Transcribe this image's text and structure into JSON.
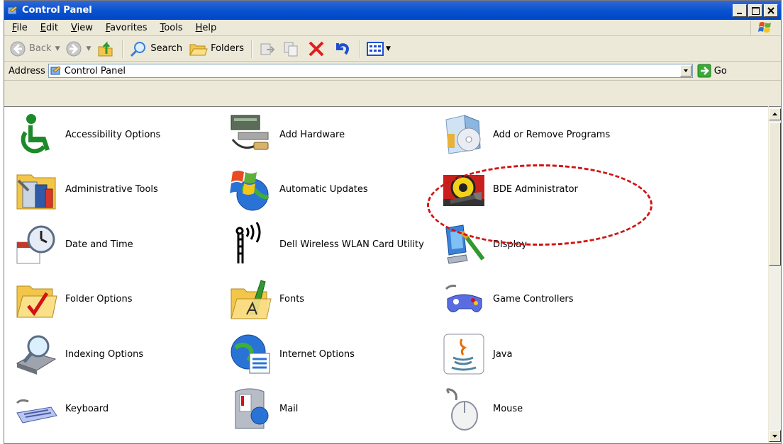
{
  "window": {
    "title": "Control Panel"
  },
  "menu": [
    "File",
    "Edit",
    "View",
    "Favorites",
    "Tools",
    "Help"
  ],
  "toolbar": {
    "back_label": "Back",
    "search_label": "Search",
    "folders_label": "Folders"
  },
  "address": {
    "label": "Address",
    "value": "Control Panel",
    "go_label": "Go"
  },
  "items": [
    {
      "label": "Accessibility Options",
      "icon": "wheelchair-icon"
    },
    {
      "label": "Add Hardware",
      "icon": "hardware-icon"
    },
    {
      "label": "Add or Remove Programs",
      "icon": "software-box-icon"
    },
    {
      "label": "Administrative Tools",
      "icon": "admin-tools-icon"
    },
    {
      "label": "Automatic Updates",
      "icon": "windows-globe-icon"
    },
    {
      "label": "BDE Administrator",
      "icon": "gear-wrench-icon"
    },
    {
      "label": "Date and Time",
      "icon": "clock-calendar-icon"
    },
    {
      "label": "Dell Wireless WLAN Card Utility",
      "icon": "wireless-antenna-icon"
    },
    {
      "label": "Display",
      "icon": "monitor-brush-icon"
    },
    {
      "label": "Folder Options",
      "icon": "folder-check-icon"
    },
    {
      "label": "Fonts",
      "icon": "fonts-folder-icon"
    },
    {
      "label": "Game Controllers",
      "icon": "gamepad-icon"
    },
    {
      "label": "Indexing Options",
      "icon": "magnifier-drive-icon"
    },
    {
      "label": "Internet Options",
      "icon": "globe-list-icon"
    },
    {
      "label": "Java",
      "icon": "java-cup-icon"
    },
    {
      "label": "Keyboard",
      "icon": "keyboard-icon"
    },
    {
      "label": "Mail",
      "icon": "mail-icon"
    },
    {
      "label": "Mouse",
      "icon": "mouse-icon"
    }
  ],
  "colors": {
    "titlebar": "#0a53d0",
    "chrome": "#ece9d8",
    "annotation": "#d31313"
  }
}
